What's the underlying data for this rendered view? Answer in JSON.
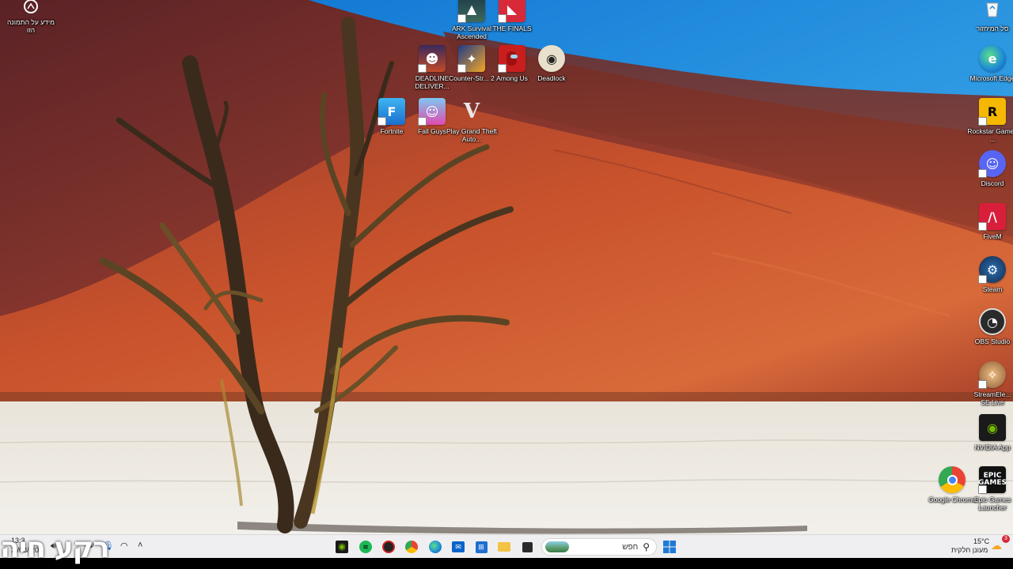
{
  "desktop": {
    "left_icons": [
      {
        "name": "about-picture",
        "label": "מידע על התמונה הזו",
        "icon": "camera-icon"
      },
      {
        "name": "ark",
        "label": "ARK Survival Ascended",
        "icon": "ark-icon"
      },
      {
        "name": "the-finals",
        "label": "THE FINALS",
        "icon": "the-finals-icon"
      },
      {
        "name": "deadline-delivery",
        "label": "DEADLINE DELIVER...",
        "icon": "deadline-delivery-icon"
      },
      {
        "name": "counter-strike",
        "label": "Counter-Str... 2",
        "icon": "counter-strike-icon"
      },
      {
        "name": "among-us",
        "label": "Among Us",
        "icon": "among-us-icon"
      },
      {
        "name": "deadlock",
        "label": "Deadlock",
        "icon": "deadlock-icon"
      },
      {
        "name": "fortnite",
        "label": "Fortnite",
        "icon": "fortnite-icon"
      },
      {
        "name": "fall-guys",
        "label": "Fall Guys",
        "icon": "fall-guys-icon"
      },
      {
        "name": "gta",
        "label": "Play Grand Theft Auto...",
        "icon": "gta-icon"
      }
    ],
    "right_icons": [
      {
        "name": "recycle-bin",
        "label": "סל המיחזור",
        "icon": "recycle-bin-icon"
      },
      {
        "name": "edge",
        "label": "Microsoft Edge",
        "icon": "edge-icon"
      },
      {
        "name": "rockstar",
        "label": "Rockstar Games ...",
        "icon": "rockstar-icon"
      },
      {
        "name": "discord",
        "label": "Discord",
        "icon": "discord-icon"
      },
      {
        "name": "fivem",
        "label": "FiveM",
        "icon": "fivem-icon"
      },
      {
        "name": "steam",
        "label": "Steam",
        "icon": "steam-icon"
      },
      {
        "name": "obs",
        "label": "OBS Studio",
        "icon": "obs-icon"
      },
      {
        "name": "streamelements",
        "label": "StreamEle... SE.Live",
        "icon": "streamelements-icon"
      },
      {
        "name": "nvidia-app",
        "label": "NVIDIA App",
        "icon": "nvidia-icon"
      },
      {
        "name": "google-chrome",
        "label": "Google Chrome",
        "icon": "chrome-icon"
      },
      {
        "name": "epic",
        "label": "Epic Games Launcher",
        "icon": "epic-games-icon"
      }
    ]
  },
  "taskbar": {
    "search_placeholder": "חפש",
    "weather_temp": "15°C",
    "weather_desc": "מעונן חלקית",
    "notification_count": "3",
    "lang": "עב",
    "clock_time": "13:3",
    "clock_date": "2 /03/ 202",
    "overlay_label": "רקע חיה",
    "apps": [
      "nvidia-icon",
      "spotify-icon",
      "app-icon",
      "chrome-icon",
      "edge-icon",
      "outlook-icon",
      "store-icon",
      "file-explorer-icon",
      "terminal-icon",
      "windows-start-icon"
    ]
  },
  "colors": {
    "sky": "#1a8fe0",
    "dune": "#b84a2a",
    "clay": "#eae6dd",
    "taskbar": "#eeeef0"
  }
}
